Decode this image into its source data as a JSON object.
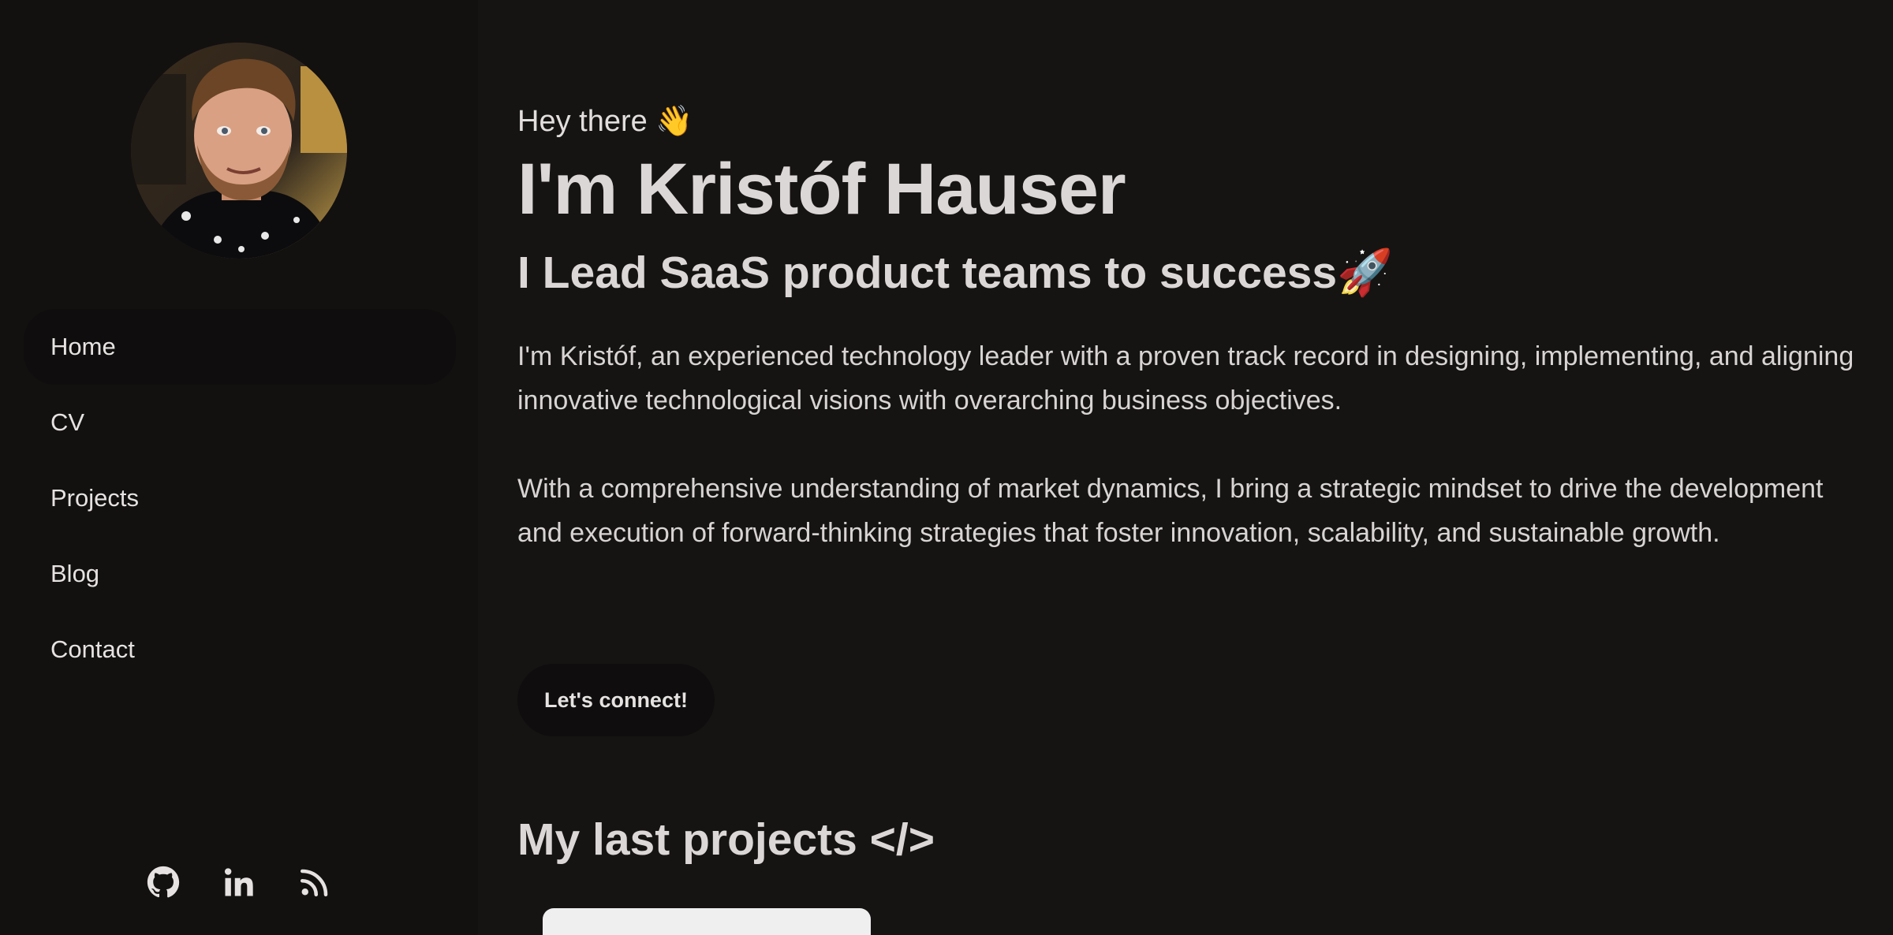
{
  "profile": {
    "avatar_alt": "avatar"
  },
  "nav": {
    "items": [
      {
        "label": "Home"
      },
      {
        "label": "CV"
      },
      {
        "label": "Projects"
      },
      {
        "label": "Blog"
      },
      {
        "label": "Contact"
      }
    ],
    "active": "Home"
  },
  "social": {
    "icons": [
      "github-icon",
      "linkedin-icon",
      "rss-icon"
    ]
  },
  "hero": {
    "greeting": "Hey there 👋",
    "name": "I'm Kristóf Hauser",
    "tagline": "I Lead SaaS product teams to success🚀",
    "bio_1": "I'm Kristóf, an experienced technology leader with a proven track record in designing, implementing, and aligning innovative technological visions with overarching business objectives.",
    "bio_2": "With a comprehensive understanding of market dynamics, I bring a strategic mindset to drive the development and execution of forward-thinking strategies that foster innovation, scalability, and sustainable growth.",
    "cta_label": "Let's connect!"
  },
  "projects": {
    "title": "My last projects </>"
  },
  "colors": {
    "background": "#161313",
    "sidebar": "#131010",
    "text": "#e2dede",
    "button": "#0f0d0d"
  }
}
